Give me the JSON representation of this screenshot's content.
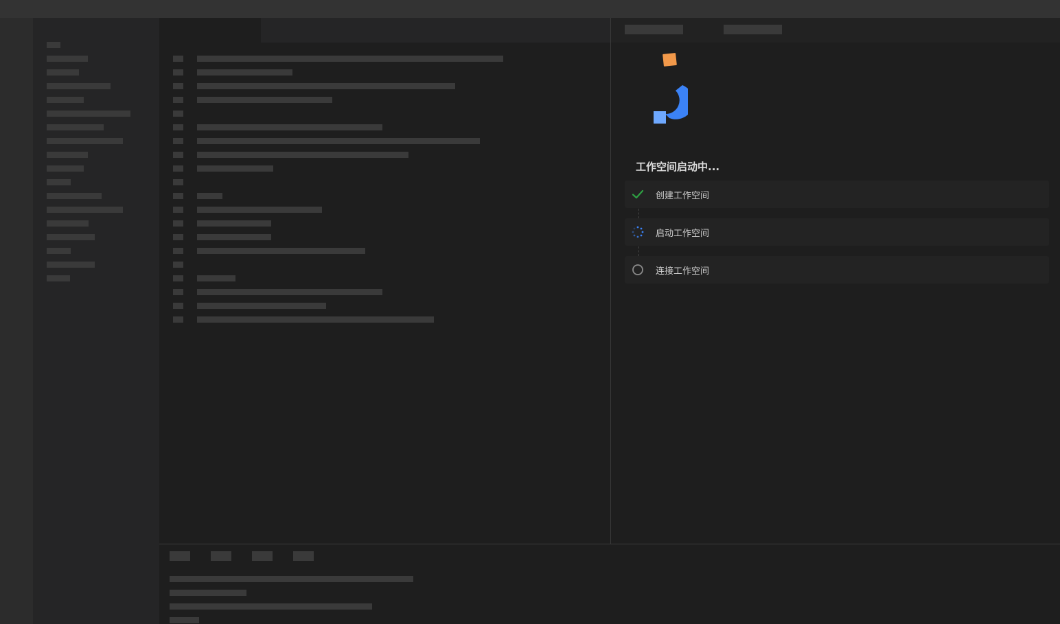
{
  "workspace": {
    "status_title": "工作空间启动中...",
    "steps": [
      {
        "label": "创建工作空间",
        "state": "done",
        "icon": "check-icon"
      },
      {
        "label": "启动工作空间",
        "state": "in-progress",
        "icon": "spinner-icon"
      },
      {
        "label": "连接工作空间",
        "state": "pending",
        "icon": "circle-icon"
      }
    ]
  },
  "colors": {
    "success": "#2ea043",
    "progress": "#3b82f6",
    "pending": "#8b8b8b",
    "logo_orange": "#f2994a",
    "logo_blue": "#3b82f6",
    "logo_light_blue": "#6ea8fe"
  },
  "icons": {
    "logo": "app-logo",
    "check": "check-icon",
    "spinner": "spinner-icon",
    "circle": "circle-icon"
  }
}
